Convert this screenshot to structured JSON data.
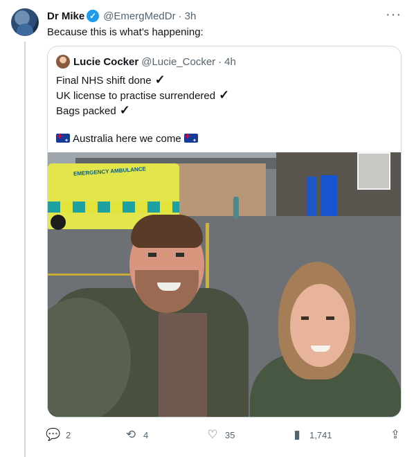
{
  "tweet": {
    "author_name": "Dr Mike",
    "handle": "@EmergMedDr",
    "separator": "·",
    "time": "3h",
    "text": "Because this is what’s happening:",
    "more_icon": "more-icon",
    "verified_icon": "verified-badge-icon"
  },
  "quote": {
    "author_name": "Lucie Cocker",
    "handle": "@Lucie_Cocker",
    "separator": "·",
    "time": "4h",
    "lines": [
      {
        "text": "Final NHS shift done",
        "icon": "✓"
      },
      {
        "text": "UK license to practise surrendered",
        "icon": "✓"
      },
      {
        "text": "Bags packed",
        "icon": "✓"
      }
    ],
    "closing_line": "Australia here we come",
    "ambulance_text": "EMERGENCY AMBULANCE"
  },
  "actions": {
    "reply_count": "2",
    "retweet_count": "4",
    "like_count": "35",
    "view_count": "1,741"
  },
  "colors": {
    "accent": "#1d9bf0",
    "text": "#0f1419",
    "muted": "#536471",
    "border": "#cfd9de"
  }
}
